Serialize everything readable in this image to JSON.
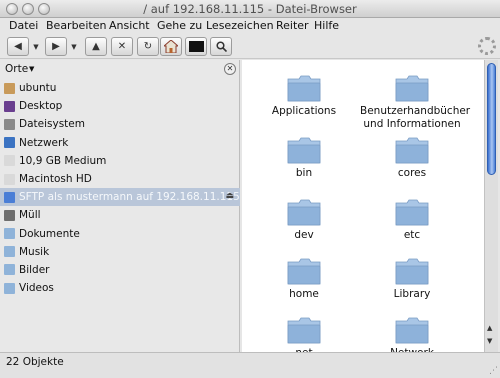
{
  "window": {
    "title": "/ auf 192.168.11.115 - Datei-Browser"
  },
  "menu": [
    "Datei",
    "Bearbeiten",
    "Ansicht",
    "Gehe zu",
    "Lesezeichen",
    "Reiter",
    "Hilfe"
  ],
  "toolbar": {
    "buttons": [
      "back-icon",
      "forward-icon",
      "up-icon",
      "stop-icon",
      "reload-icon",
      "home-icon",
      "computer-icon",
      "search-icon"
    ]
  },
  "sidebar": {
    "header_label": "Orte",
    "places": [
      {
        "label": "ubuntu",
        "icon": "home-folder-icon",
        "color": "#c89a5a"
      },
      {
        "label": "Desktop",
        "icon": "desktop-icon",
        "color": "#6a3f8f"
      },
      {
        "label": "Dateisystem",
        "icon": "filesystem-icon",
        "color": "#8a8a8a"
      },
      {
        "label": "Netzwerk",
        "icon": "network-icon",
        "color": "#3b73c2"
      },
      {
        "label": "10,9 GB Medium",
        "icon": "drive-icon",
        "color": "#d9d9d9"
      },
      {
        "label": "Macintosh HD",
        "icon": "drive-icon",
        "color": "#d9d9d9"
      },
      {
        "label": "SFTP als mustermann auf 192.168.11.115",
        "icon": "network-drive-icon",
        "color": "#4a7ed6",
        "selected": true
      },
      {
        "label": "Müll",
        "icon": "trash-icon",
        "color": "#6e6e6e"
      },
      {
        "label": "Dokumente",
        "icon": "folder-icon",
        "color": "#8fb3d9"
      },
      {
        "label": "Musik",
        "icon": "folder-icon",
        "color": "#8fb3d9"
      },
      {
        "label": "Bilder",
        "icon": "folder-icon",
        "color": "#8fb3d9"
      },
      {
        "label": "Videos",
        "icon": "folder-icon",
        "color": "#8fb3d9"
      }
    ]
  },
  "files": [
    {
      "label": "Applications"
    },
    {
      "label": "Benutzerhandbücher und Informationen"
    },
    {
      "label": "bin"
    },
    {
      "label": "cores"
    },
    {
      "label": "dev"
    },
    {
      "label": "etc"
    },
    {
      "label": "home"
    },
    {
      "label": "Library"
    },
    {
      "label": "net"
    },
    {
      "label": "Network"
    }
  ],
  "status": {
    "text": "22 Objekte"
  },
  "colors": {
    "folder_top": "#a9c6e6",
    "folder_body": "#8eb2da",
    "selection": "#b9c6d9"
  }
}
